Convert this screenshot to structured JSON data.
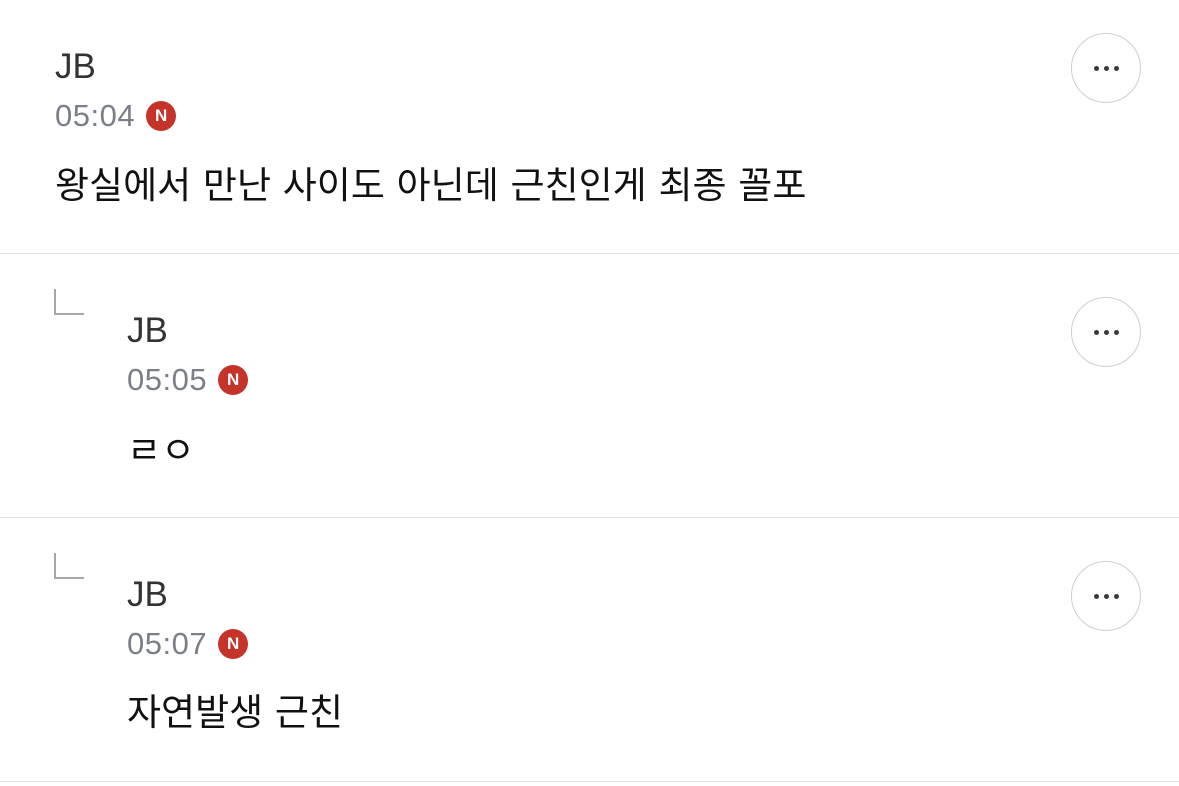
{
  "comments": [
    {
      "author": "JB",
      "time": "05:04",
      "badge": "N",
      "text": "왕실에서 만난 사이도 아닌데 근친인게 최종 꼴포",
      "is_reply": false,
      "more_icon": "more-horizontal-icon"
    },
    {
      "author": "JB",
      "time": "05:05",
      "badge": "N",
      "text": "ㄹㅇ",
      "is_reply": true,
      "more_icon": "more-horizontal-icon"
    },
    {
      "author": "JB",
      "time": "05:07",
      "badge": "N",
      "text": "자연발생 근친",
      "is_reply": true,
      "more_icon": "more-horizontal-icon"
    }
  ],
  "colors": {
    "badge": "#c4342b",
    "time": "#7b7f87",
    "divider": "#dcdcdc",
    "text": "#111111"
  }
}
